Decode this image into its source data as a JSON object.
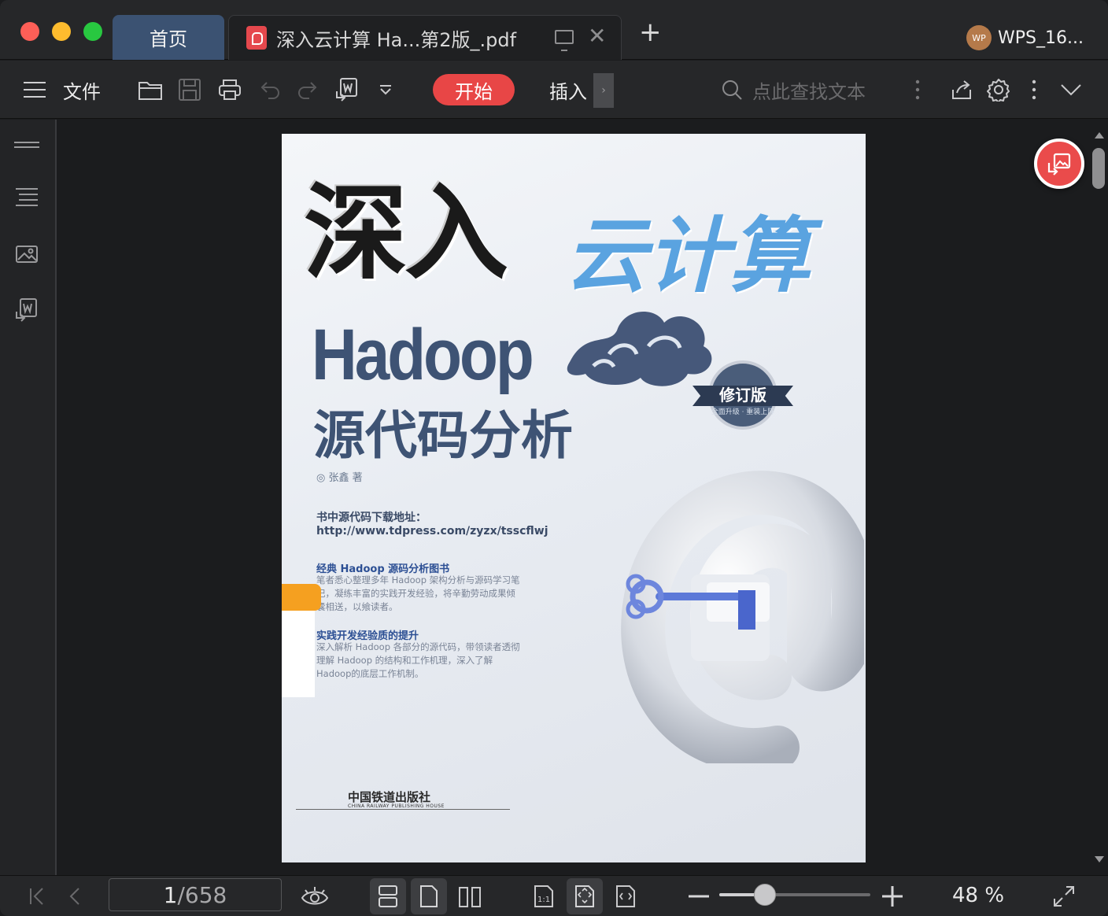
{
  "titlebar": {
    "home_tab": "首页",
    "doc_tab": "深入云计算 Ha...第2版_.pdf",
    "new_tab_label": "+",
    "close_glyph": "✕",
    "user": {
      "avatar": "WP",
      "name": "WPS_16..."
    }
  },
  "toolbar": {
    "file_label": "文件",
    "start_label": "开始",
    "insert_label": "插入",
    "insert_more": "›",
    "search_placeholder": "点此查找文本",
    "icons": [
      "menu-icon",
      "open-folder-icon",
      "save-icon",
      "print-icon",
      "undo-icon",
      "redo-icon",
      "export-word-icon",
      "dropdown-icon",
      "search-icon",
      "more-vertical-icon",
      "share-icon",
      "settings-icon",
      "more-vertical-icon",
      "collapse-icon"
    ]
  },
  "sidebar": {
    "icons": [
      "thumbnail-icon",
      "outline-icon",
      "image-icon",
      "pdf-to-word-icon"
    ]
  },
  "document": {
    "title_black": "深入",
    "title_blue": "云计算",
    "hadoop": "Hadoop",
    "subtitle": "源代码分析",
    "badge": "修订版",
    "badge_small": "全面升级 · 重装上阵",
    "author": "◎ 张鑫  著",
    "download_label": "书中源代码下载地址：",
    "download_url": "http://www.tdpress.com/zyzx/tsscflwj",
    "section1_title": "经典 Hadoop 源码分析图书",
    "section1_body": "笔者悉心整理多年 Hadoop 架构分析与源码学习笔记，凝练丰富的实践开发经验，将辛勤劳动成果倾囊相送，以飨读者。",
    "section2_title": "实践开发经验质的提升",
    "section2_body": "深入解析 Hadoop 各部分的源代码，带领读者透彻理解 Hadoop 的结构和工作机理，深入了解Hadoop的底层工作机制。",
    "publisher": "中国铁道出版社",
    "publisher_en": "CHINA RAILWAY PUBLISHING HOUSE"
  },
  "statusbar": {
    "current_page": "1",
    "total_pages": "/658",
    "zoom": "48 %",
    "zoom_fraction": 0.3,
    "colors": {
      "accent": "#e84646",
      "home_tab": "#3b5272"
    }
  }
}
